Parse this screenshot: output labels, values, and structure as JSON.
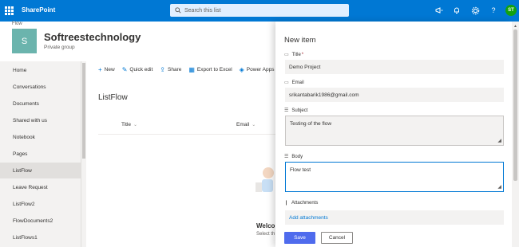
{
  "topbar": {
    "app_name": "SharePoint",
    "search_placeholder": "Search this list",
    "avatar_initials": "ST",
    "brand_color": "#0078d4"
  },
  "site": {
    "breadcrumb": "Flow",
    "logo_letter": "S",
    "name": "Softreestechnology",
    "subtitle": "Private group"
  },
  "nav": {
    "items": [
      {
        "label": "Home"
      },
      {
        "label": "Conversations"
      },
      {
        "label": "Documents"
      },
      {
        "label": "Shared with us"
      },
      {
        "label": "Notebook"
      },
      {
        "label": "Pages"
      },
      {
        "label": "ListFlow",
        "selected": true
      },
      {
        "label": "Leave Request"
      },
      {
        "label": "ListFlow2"
      },
      {
        "label": "FlowDocuments2"
      },
      {
        "label": "ListFlows1"
      }
    ]
  },
  "commandbar": {
    "new": "New",
    "quick_edit": "Quick edit",
    "share": "Share",
    "export": "Export to Excel",
    "power_apps": "Power Apps"
  },
  "list": {
    "title": "ListFlow",
    "columns": [
      "Title",
      "Email"
    ],
    "welcome": "Welco",
    "welcome_sub": "Select th"
  },
  "panel": {
    "title": "New item",
    "fields": {
      "title_label": "Title",
      "title_required": "*",
      "title_value": "Demo Project",
      "email_label": "Email",
      "email_value": "srikantabarik1986@gmail.com",
      "subject_label": "Subject",
      "subject_value": "Testing of the flow",
      "body_label": "Body",
      "body_value": "Flow test",
      "attachments_label": "Attachments",
      "add_attachments": "Add attachments"
    },
    "save": "Save",
    "cancel": "Cancel"
  }
}
